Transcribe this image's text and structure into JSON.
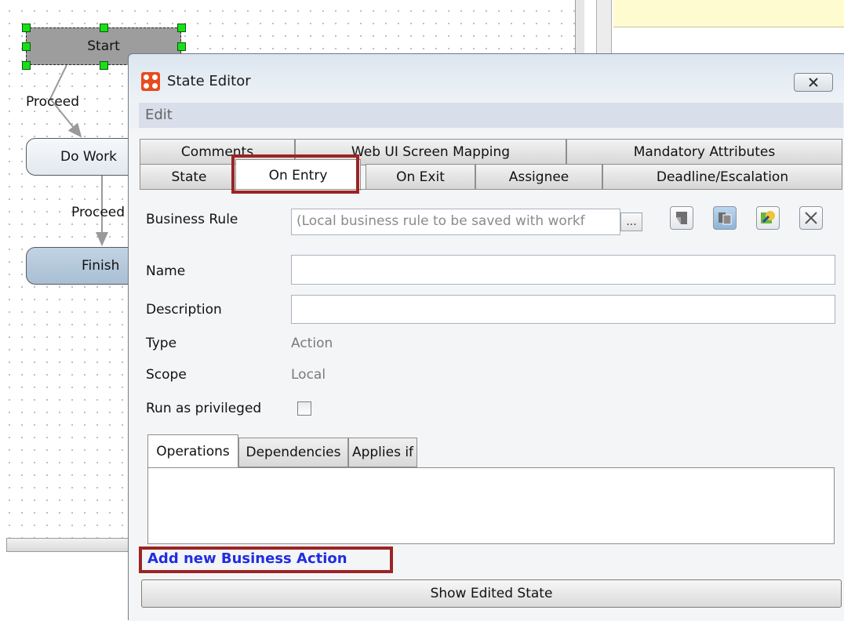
{
  "workflow": {
    "nodes": {
      "start": "Start",
      "do_work": "Do Work",
      "finish": "Finish"
    },
    "edges": {
      "first": "Proceed",
      "second": "Proceed"
    }
  },
  "dialog": {
    "title": "State Editor",
    "close_icon": "close-icon",
    "menu": {
      "edit": "Edit"
    },
    "tabs_row1": [
      "Comments",
      "Web UI Screen Mapping",
      "Mandatory Attributes"
    ],
    "tabs_row2": [
      "State",
      "On Entry",
      "On Exit",
      "Assignee",
      "Deadline/Escalation"
    ],
    "active_tab": "On Entry",
    "form": {
      "business_rule_label": "Business Rule",
      "business_rule_value": "(Local business rule to be saved with workf",
      "browse_label": "...",
      "name_label": "Name",
      "name_value": "",
      "description_label": "Description",
      "description_value": "",
      "type_label": "Type",
      "type_value": "Action",
      "scope_label": "Scope",
      "scope_value": "Local",
      "run_privileged_label": "Run as privileged",
      "run_privileged_checked": false
    },
    "toolbar_icons": [
      "edit-rule-icon",
      "copy-rule-icon",
      "rule-wizard-icon",
      "delete-icon"
    ],
    "subtabs": [
      "Operations",
      "Dependencies",
      "Applies if"
    ],
    "add_action_link": "Add new Business Action",
    "show_edited_button": "Show Edited State"
  },
  "colors": {
    "highlight": "#9b2424",
    "link": "#1f2ee0",
    "app_icon": "#e84b1c",
    "selection_handle": "#18e018"
  }
}
